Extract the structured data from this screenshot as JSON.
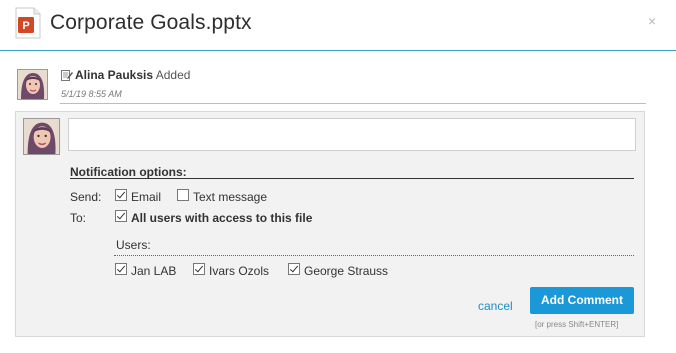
{
  "dialog": {
    "title": "Corporate Goals.pptx",
    "close_glyph": "×",
    "file_type_icon": "powerpoint-icon",
    "accent_color": "#1b98d7"
  },
  "activity": {
    "user": "Alina Pauksis",
    "action": "Added",
    "timestamp": "5/1/19 8:55 AM"
  },
  "comment": {
    "placeholder": "",
    "notification_options_label": "Notification options:",
    "send_label": "Send:",
    "send_options": [
      {
        "label": "Email",
        "checked": true
      },
      {
        "label": "Text message",
        "checked": false
      }
    ],
    "to_label": "To:",
    "to_option": {
      "label": "All users with access to this file",
      "checked": true
    },
    "users_label": "Users:",
    "users": [
      {
        "label": "Jan LAB",
        "checked": true
      },
      {
        "label": "Ivars Ozols",
        "checked": true
      },
      {
        "label": "George Strauss",
        "checked": true
      }
    ],
    "cancel_label": "cancel",
    "add_label": "Add Comment",
    "hint": "[or press Shift+ENTER]"
  }
}
